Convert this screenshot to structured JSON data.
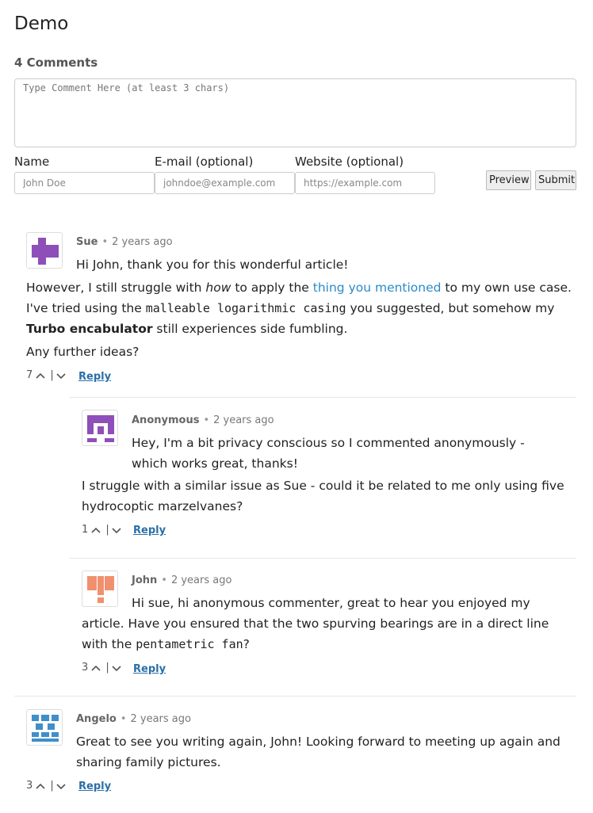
{
  "page": {
    "title": "Demo"
  },
  "comments_header": {
    "count_label": "4 Comments"
  },
  "form": {
    "comment_placeholder": "Type Comment Here (at least 3 chars)",
    "name_label": "Name",
    "name_placeholder": "John Doe",
    "email_label": "E-mail (optional)",
    "email_placeholder": "johndoe@example.com",
    "website_label": "Website (optional)",
    "website_placeholder": "https://example.com",
    "preview_label": "Preview",
    "submit_label": "Submit"
  },
  "comments": [
    {
      "author": "Sue",
      "time": "2 years ago",
      "votes": "7",
      "reply_label": "Reply",
      "avatar_color": "#8e4fb9",
      "line1": "Hi John, thank you for this wonderful article!",
      "p1_a": "However, I still struggle with ",
      "p1_em": "how",
      "p1_b": " to apply the ",
      "p1_link": "thing you mentioned",
      "p1_c": " to my own use case. I've tried using the ",
      "p1_code": "malleable logarithmic casing",
      "p1_d": " you suggested, but somehow my ",
      "p1_strong": "Turbo encabulator",
      "p1_e": " still experiences side fumbling.",
      "p2": "Any further ideas?"
    },
    {
      "author": "Anonymous",
      "time": "2 years ago",
      "votes": "1",
      "reply_label": "Reply",
      "avatar_color": "#8e4fb9",
      "line1": "Hey, I'm a bit privacy conscious so I commented anonymously - which works great, thanks!",
      "p1": "I struggle with a similar issue as Sue - could it be related to me only using five hydrocoptic marzelvanes?"
    },
    {
      "author": "John",
      "time": "2 years ago",
      "votes": "3",
      "reply_label": "Reply",
      "avatar_color": "#f0906e",
      "line1": "Hi sue, hi anonymous commenter, great to hear you enjoyed my article. Have you ensured that the two spurving bearings are in a direct line with the ",
      "code": "pentametric fan",
      "tail": "?"
    },
    {
      "author": "Angelo",
      "time": "2 years ago",
      "votes": "3",
      "reply_label": "Reply",
      "avatar_color": "#3f8fc9",
      "line1": "Great to see you writing again, John! Looking forward to meeting up again and sharing family pictures."
    }
  ]
}
